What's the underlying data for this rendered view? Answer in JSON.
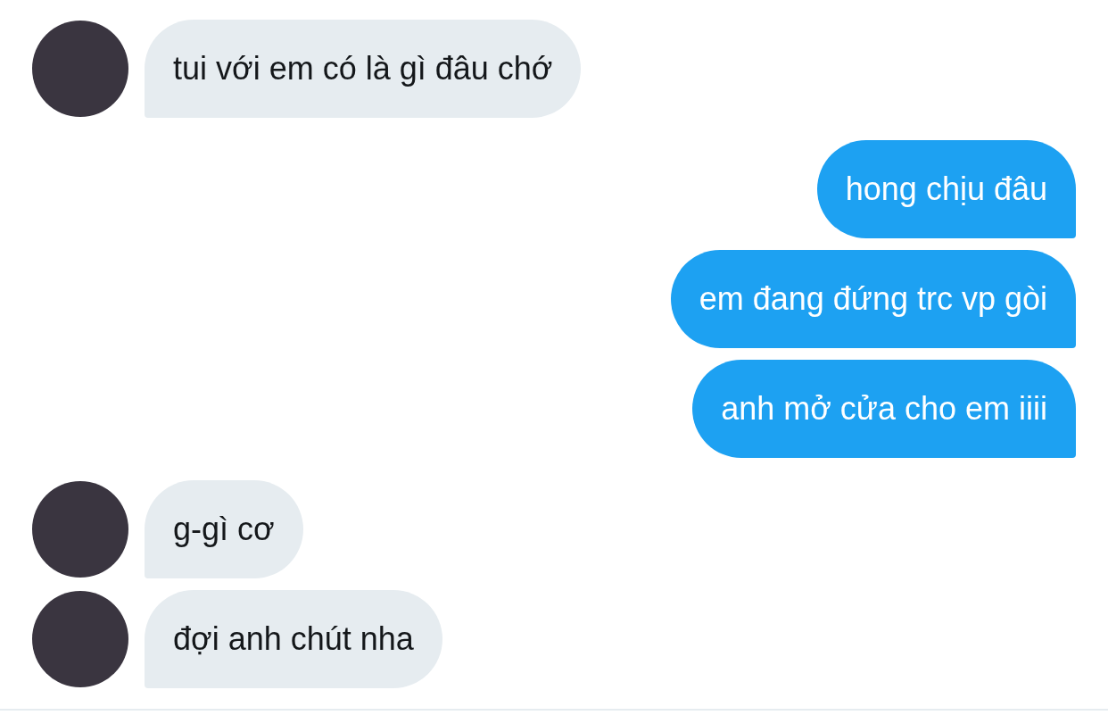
{
  "messages": [
    {
      "kind": "received",
      "text": "tui với em có là gì đâu chớ"
    },
    {
      "kind": "sent",
      "text": "hong chịu đâu"
    },
    {
      "kind": "sent",
      "text": "em đang đứng trc vp gòi"
    },
    {
      "kind": "sent",
      "text": "anh mở cửa cho em iiii"
    },
    {
      "kind": "received",
      "text": "g-gì cơ"
    },
    {
      "kind": "received",
      "text": "đợi anh chút nha"
    }
  ]
}
